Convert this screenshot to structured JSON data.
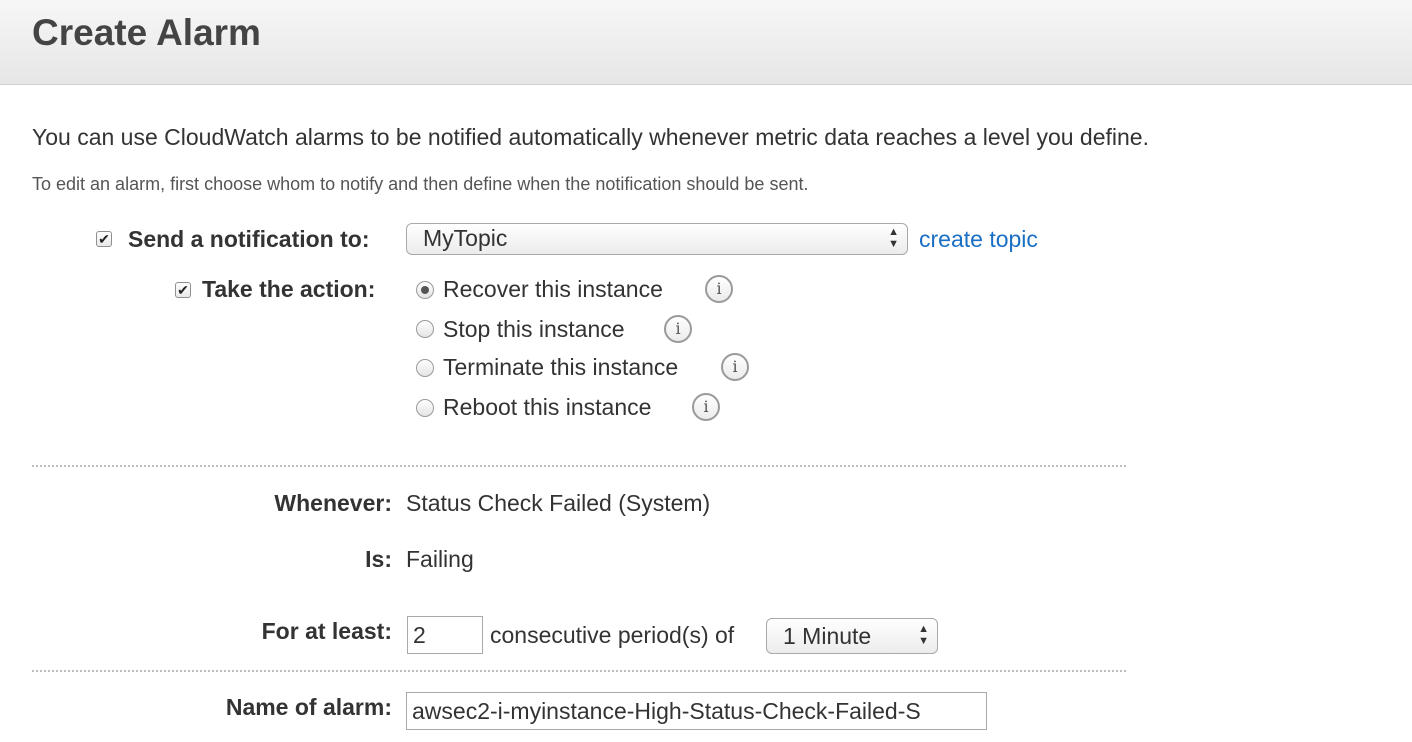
{
  "header": {
    "title": "Create Alarm"
  },
  "intro": {
    "text": "You can use CloudWatch alarms to be notified automatically whenever metric data reaches a level you define.",
    "subtext": "To edit an alarm, first choose whom to notify and then define when the notification should be sent."
  },
  "notification": {
    "checked": true,
    "label": "Send a notification to:",
    "topic_value": "MyTopic",
    "create_topic_link": "create topic"
  },
  "action": {
    "checked": true,
    "label": "Take the action:",
    "options": [
      {
        "label": "Recover this instance",
        "selected": true
      },
      {
        "label": "Stop this instance",
        "selected": false
      },
      {
        "label": "Terminate this instance",
        "selected": false
      },
      {
        "label": "Reboot this instance",
        "selected": false
      }
    ]
  },
  "condition": {
    "whenever_label": "Whenever:",
    "whenever_value": "Status Check Failed (System)",
    "is_label": "Is:",
    "is_value": "Failing",
    "for_at_least_label": "For at least:",
    "periods_value": "2",
    "consecutive_text": "consecutive period(s) of",
    "period_value": "1 Minute"
  },
  "name": {
    "label": "Name of alarm:",
    "value": "awsec2-i-myinstance-High-Status-Check-Failed-S"
  },
  "icons": {
    "checkbox_check": "✔",
    "info": "i",
    "select_up": "▲",
    "select_down": "▼"
  }
}
